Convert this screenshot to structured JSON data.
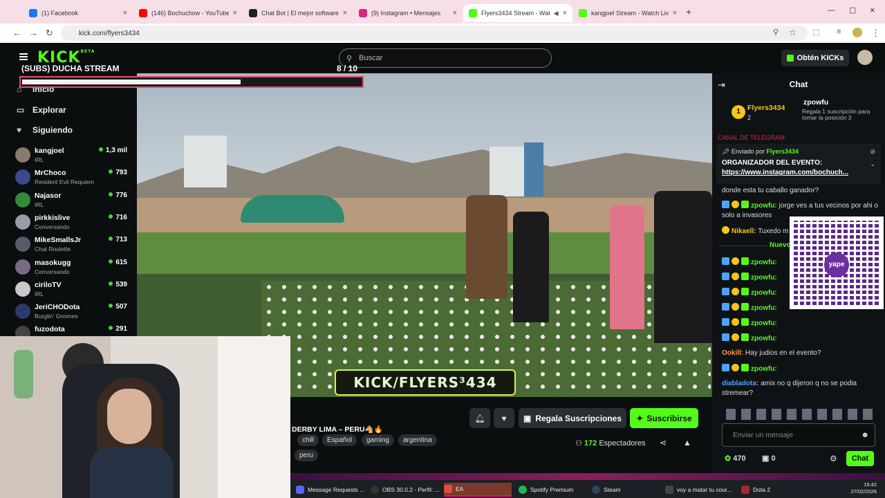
{
  "browser": {
    "tabs": [
      {
        "label": "(1) Facebook",
        "color": "#1877f2"
      },
      {
        "label": "(146) Bochuchow - YouTube",
        "color": "#ff0000"
      },
      {
        "label": "Chat Bot | El mejor software pa",
        "color": "#222222"
      },
      {
        "label": "(9) Instagram • Mensajes",
        "color": "#d62976"
      },
      {
        "label": "Flyers3434 Stream - Watch",
        "color": "#53fc18"
      },
      {
        "label": "kangjoel Stream - Watch Live o",
        "color": "#53fc18"
      }
    ],
    "url": "kick.com/flyers3434"
  },
  "header": {
    "logo": "KICK",
    "logo_badge": "BETA",
    "search_placeholder": "Buscar",
    "kicks_button": "Obtén KICKs"
  },
  "overlay": {
    "title": "(SUBS) DUCHA STREAM",
    "count": "8  / 10",
    "progress": 0.8
  },
  "sidebar": {
    "nav": [
      {
        "label": "Inicio",
        "icon": "home-icon",
        "glyph": "⌂"
      },
      {
        "label": "Explorar",
        "icon": "compass-icon",
        "glyph": "▭"
      },
      {
        "label": "Siguiendo",
        "icon": "heart-icon",
        "glyph": "♥"
      }
    ],
    "channels": [
      {
        "name": "kangjoel",
        "game": "IRL",
        "viewers": "1,3 mil",
        "color": "#8a7a6a"
      },
      {
        "name": "MrChoco",
        "game": "Resident Evil Requiem",
        "viewers": "793",
        "color": "#3a4a8a"
      },
      {
        "name": "Najasor",
        "game": "IRL",
        "viewers": "776",
        "color": "#2f8a3a"
      },
      {
        "name": "pirkkislive",
        "game": "Conversando",
        "viewers": "716",
        "color": "#9a9aa8"
      },
      {
        "name": "MikeSmallsJr",
        "game": "Chat Roulette",
        "viewers": "713",
        "color": "#5a5a6a"
      },
      {
        "name": "masokugg",
        "game": "Conversando",
        "viewers": "615",
        "color": "#7a6a8a"
      },
      {
        "name": "ciriloTV",
        "game": "IRL",
        "viewers": "539",
        "color": "#c9c9c9"
      },
      {
        "name": "JeriCHODota",
        "game": "Burglin' Gnomes",
        "viewers": "507",
        "color": "#2a3a6a"
      },
      {
        "name": "fuzodota",
        "game": "",
        "viewers": "291",
        "color": "#444444"
      }
    ]
  },
  "video": {
    "banner": "KICK/FLYERS³434"
  },
  "stream": {
    "title": "DERBY LIMA – PERU🐴🔥",
    "tags": [
      "chill",
      "Español",
      "gaming",
      "argentina",
      "peru"
    ],
    "gift_label": "Regala Suscripciones",
    "subscribe_label": "Suscribirse",
    "viewers": "172",
    "viewers_label": "Espectadores"
  },
  "chat": {
    "title": "Chat",
    "leaderboard": [
      {
        "name": "Flyers3434",
        "count": "2"
      },
      {
        "name": "zpowfu",
        "note": "Regala 1 suscripción para tomar la posición 3"
      }
    ],
    "partial_top": "CANAL DE TELEGRAM:",
    "pinned": {
      "by_label": "Enviado por",
      "by": "Flyers3434",
      "title": "ORGANIZADOR DEL EVENTO:",
      "link": "https://www.instagram.com/bochuch..."
    },
    "messages_top": [
      {
        "user": "",
        "text": "donde esta tu caballo ganador?"
      },
      {
        "user": "zpowfu:",
        "text": "jorge ves a tus vecinos por ahi o solo a invasores",
        "color": "#53fc18"
      },
      {
        "user": "Nikaell:",
        "text": "Tuxedo m",
        "color": "#f5c518"
      }
    ],
    "new_label": "Nuevo",
    "repeat_user": "zpowfu:",
    "messages_bottom": [
      {
        "user": "Ookill:",
        "text": "Hay judios en el evento?",
        "color": "#ff9a3c"
      },
      {
        "user": "zpowfu:",
        "text": "",
        "color": "#53fc18"
      },
      {
        "user": "diabladota:",
        "text": "amix no q dijeron q no se podia stremear?",
        "color": "#4aa3ff"
      }
    ],
    "qr_label": "yape",
    "input_placeholder": "Enviar un mensaje",
    "points": "470",
    "gifts": "0",
    "send_label": "Chat"
  },
  "taskbar": {
    "items": [
      {
        "label": "Message Requests ...",
        "color": "#5865f2"
      },
      {
        "label": "OBS 30.0.2 - Perfil: ...",
        "color": "#333333"
      },
      {
        "label": "EA",
        "color": "#e24a3b"
      },
      {
        "label": "Spotify Premium",
        "color": "#1db954"
      },
      {
        "label": "Steam",
        "color": "#2a475e"
      },
      {
        "label": "voy a matar tu cour...",
        "color": "#444444"
      },
      {
        "label": "Dota 2",
        "color": "#a12b2b"
      }
    ],
    "time": "15:42",
    "date": "27/02/2026"
  }
}
